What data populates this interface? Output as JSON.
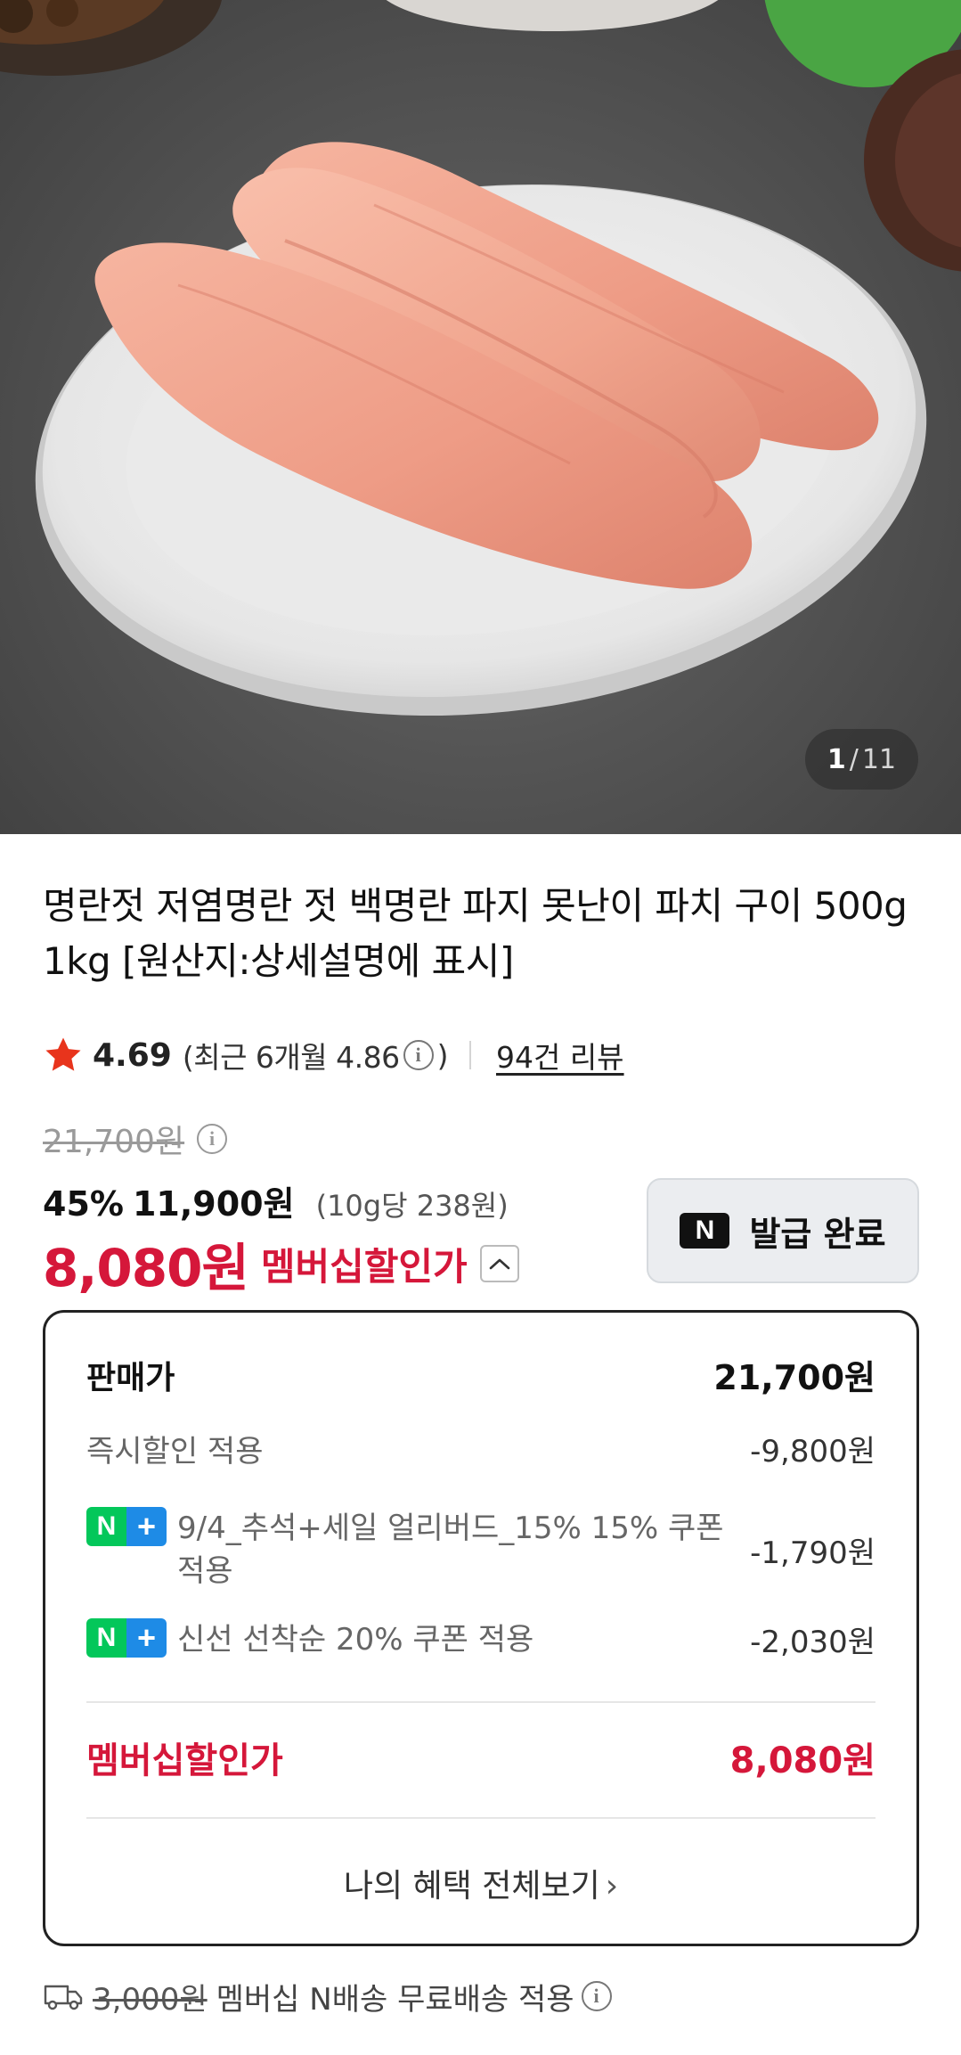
{
  "image": {
    "current_page": "1",
    "separator": "/",
    "total_pages": "11"
  },
  "product": {
    "title": "명란젓 저염명란 젓 백명란 파지 못난이 파치 구이 500g 1kg [원산지:상세설명에 표시]",
    "rating": "4.69",
    "recent_rating": "(최근 6개월 4.86",
    "recent_rating_close": ")",
    "review_count": "94건 리뷰"
  },
  "price": {
    "original": "21,700원",
    "discount_rate": "45%",
    "sale_price": "11,900원",
    "unit_price": "(10g당 238원)",
    "member_price": "8,080원",
    "member_label": "멤버십할인가"
  },
  "coupon_button": {
    "logo": "N",
    "label": "발급 완료"
  },
  "breakdown": {
    "sale_label": "판매가",
    "sale_value": "21,700원",
    "instant_label": "즉시할인 적용",
    "instant_value": "-9,800원",
    "coupon1_tag_n": "N",
    "coupon1_tag_plus": "+",
    "coupon1_label": "9/4_추석+세일 얼리버드_15% 15% 쿠폰 적용",
    "coupon1_value": "-1,790원",
    "coupon2_tag_n": "N",
    "coupon2_tag_plus": "+",
    "coupon2_label": "신선 선착순 20% 쿠폰 적용",
    "coupon2_value": "-2,030원",
    "member_label": "멤버십할인가",
    "member_value": "8,080원",
    "benefits_link": "나의 혜택 전체보기",
    "benefits_arrow": "›"
  },
  "shipping": {
    "fee": "3,000원",
    "text": "멤버십 N배송 무료배송 적용"
  },
  "icons": {
    "info": "i",
    "star_color": "#e8341c",
    "accent_red": "#d5173a",
    "naver_green": "#03c75a",
    "plus_blue": "#1e8be6"
  }
}
